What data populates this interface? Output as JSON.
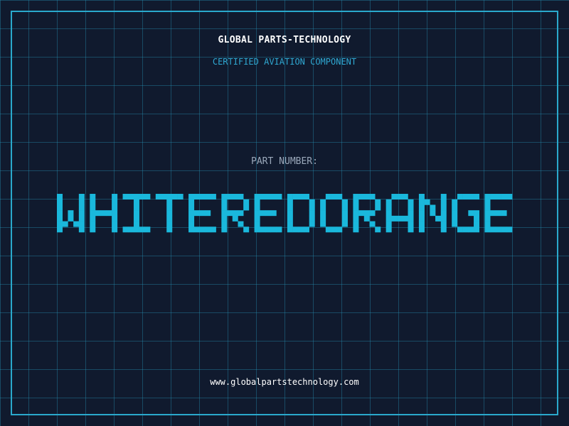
{
  "company_name": "GLOBAL PARTS-TECHNOLOGY",
  "tagline": "CERTIFIED AVIATION COMPONENT",
  "part_label": "PART NUMBER:",
  "part_number": "WHITEREDORANGE",
  "website": "www.globalpartstechnology.com",
  "colors": {
    "background": "#101a2e",
    "grid": "#268caf",
    "frame": "#2aa9cc",
    "accent": "#1ab8dc",
    "company": "#ffffff",
    "label": "#9aa8ba"
  }
}
